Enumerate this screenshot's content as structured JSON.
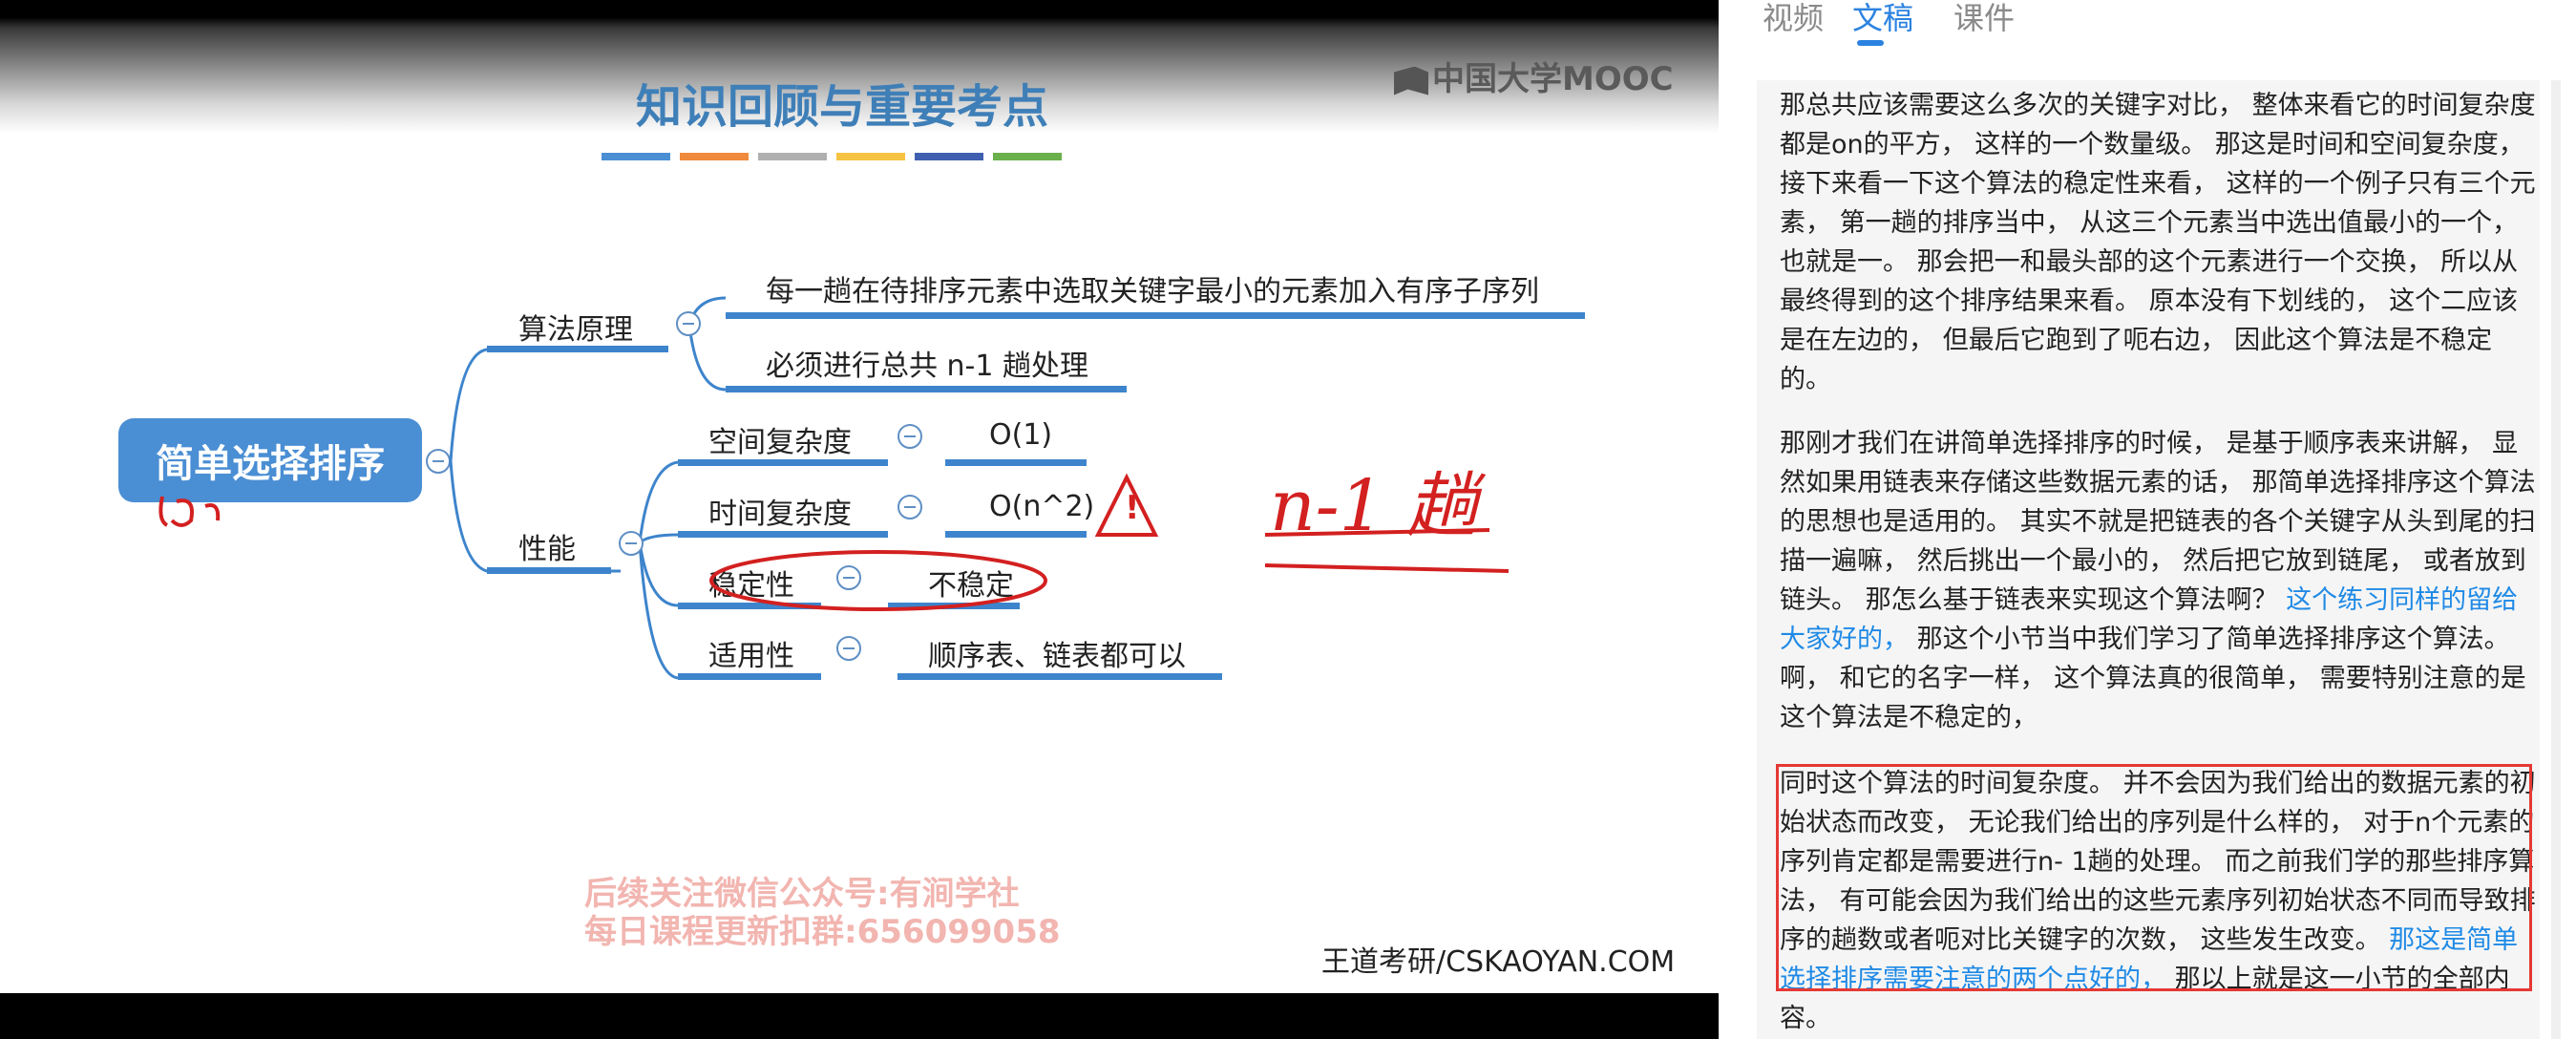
{
  "tabs": [
    {
      "label": "视频",
      "active": false
    },
    {
      "label": "文稿",
      "active": true
    },
    {
      "label": "课件",
      "active": false
    }
  ],
  "slide": {
    "brand": "中国大学MOOC",
    "title": "知识回顾与重要考点",
    "title_bar_colors": [
      "#4a8ed4",
      "#f08a3c",
      "#b0b0b0",
      "#f5c242",
      "#3f5fb0",
      "#6ab04c"
    ],
    "mindmap": {
      "root": "简单选择排序",
      "algorithm": {
        "label": "算法原理",
        "items": [
          "每一趟在待排序元素中选取关键字最小的元素加入有序子序列",
          "必须进行总共 n-1 趟处理"
        ]
      },
      "performance": {
        "label": "性能",
        "rows": [
          {
            "key": "空间复杂度",
            "value": "O(1)"
          },
          {
            "key": "时间复杂度",
            "value": "O(n^2)"
          },
          {
            "key": "稳定性",
            "value": "不稳定"
          },
          {
            "key": "适用性",
            "value": "顺序表、链表都可以"
          }
        ]
      }
    },
    "handwriting": {
      "note": "n-1 趟",
      "warning": "!"
    },
    "watermark": [
      "后续关注微信公众号:有涧学社",
      "每日课程更新扣群:656099058"
    ],
    "credit": "王道考研/CSKAOYAN.COM"
  },
  "transcript": {
    "p1": "那总共应该需要这么多次的关键字对比， 整体来看它的时间复杂度都是on的平方， 这样的一个数量级。 那这是时间和空间复杂度， 接下来看一下这个算法的稳定性来看， 这样的一个例子只有三个元素， 第一趟的排序当中， 从这三个元素当中选出值最小的一个， 也就是一。 那会把一和最头部的这个元素进行一个交换， 所以从最终得到的这个排序结果来看。 原本没有下划线的， 这个二应该是在左边的， 但最后它跑到了呃右边， 因此这个算法是不稳定的。",
    "p2_before": "那刚才我们在讲简单选择排序的时候， 是基于顺序表来讲解， 显然如果用链表来存储这些数据元素的话， 那简单选择排序这个算法的思想也是适用的。 其实不就是把链表的各个关键字从头到尾的扫描一遍嘛， 然后挑出一个最小的， 然后把它放到链尾， 或者放到链头。 那怎么基于链表来实现这个算法啊？ ",
    "p2_highlight": "这个练习同样的留给大家好的，",
    "p2_after": " 那这个小节当中我们学习了简单选择排序这个算法。 啊， 和它的名字一样， 这个算法真的很简单， 需要特别注意的是这个算法是不稳定的，",
    "p3_before": "同时这个算法的时间复杂度。 并不会因为我们给出的数据元素的初始状态而改变， 无论我们给出的序列是什么样的， 对于n个元素的序列肯定都是需要进行n- 1趟的处理。 而之前我们学的那些排序算法， 有可能会因为我们给出的这些元素序列初始状态不同而导致排序的趟数或者呃对比关键字的次数， 这些发生改变。 ",
    "p3_highlight": "那这是简单选择排序需要注意的两个点好的，",
    "p3_after": " 那以上就是这一小节的全部内容。"
  }
}
